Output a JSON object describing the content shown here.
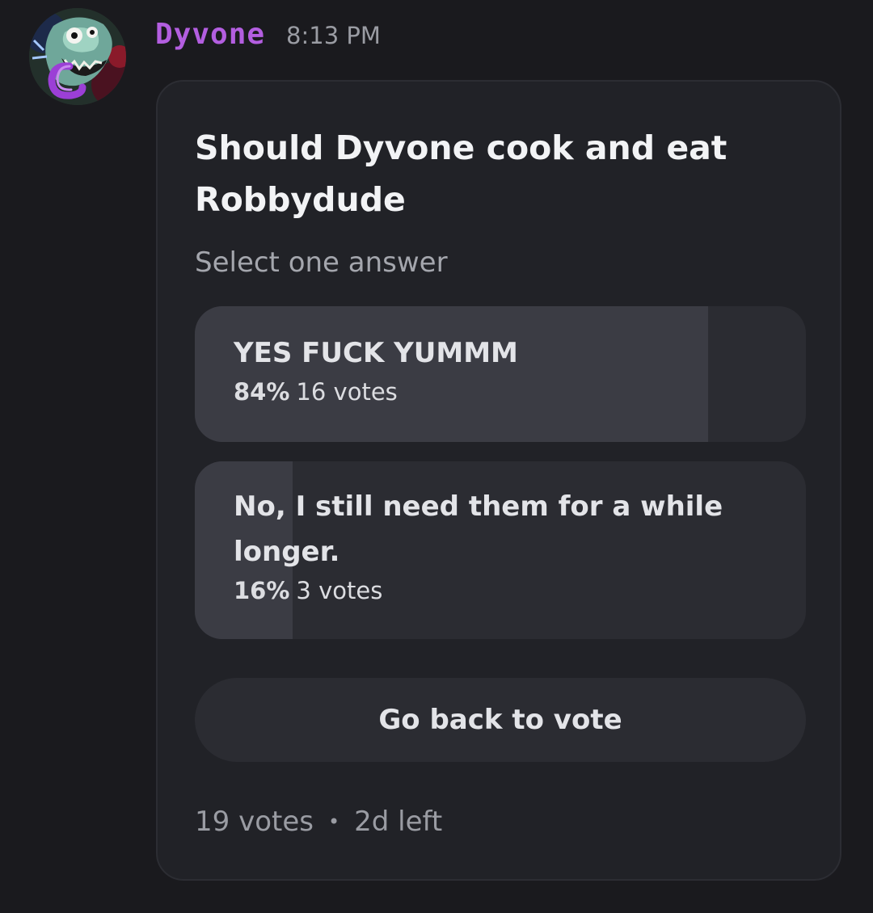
{
  "message": {
    "author": "Dyvone",
    "timestamp": "8:13 PM",
    "author_color": "#b35ee0"
  },
  "poll": {
    "question": "Should Dyvone cook and eat Robbydude",
    "hint": "Select one answer",
    "answers": [
      {
        "text": "YES FUCK YUMMM",
        "percent_label": "84%",
        "votes_label": "16 votes",
        "share": 0.84
      },
      {
        "text": "No, I still need them for a while longer.",
        "percent_label": "16%",
        "votes_label": "3 votes",
        "share": 0.16
      }
    ],
    "back_button_label": "Go back to vote",
    "total_votes": "19 votes",
    "separator": "•",
    "time_left": "2d left"
  },
  "icons": {
    "avatar": "monster-avatar-icon"
  },
  "colors": {
    "background": "#1a1a1e",
    "card": "#212227",
    "answer_bg": "#2b2c32",
    "answer_fill": "#3b3c44"
  }
}
